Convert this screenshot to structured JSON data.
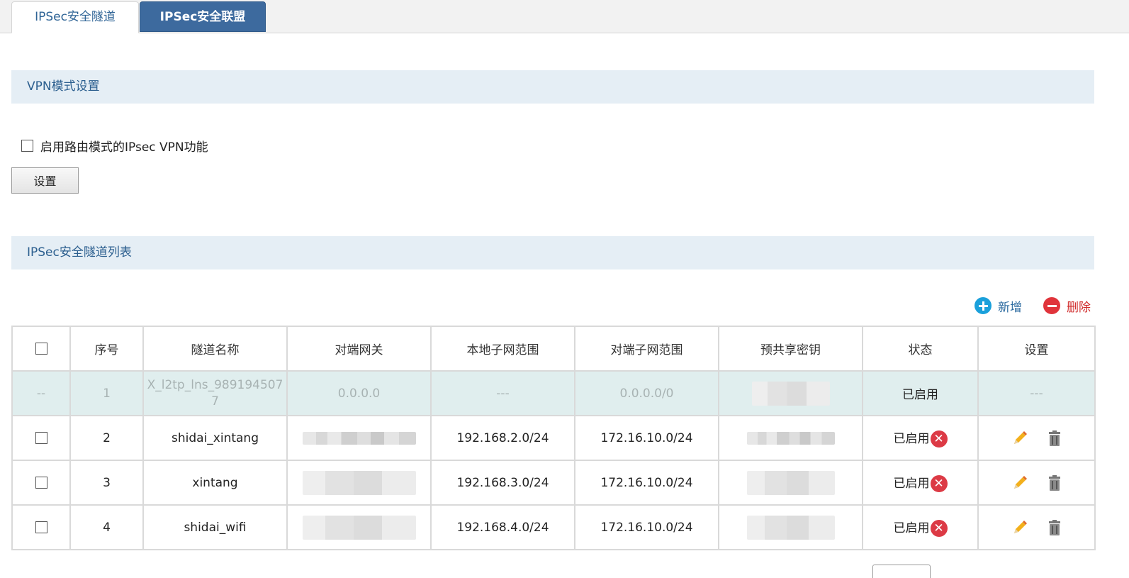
{
  "tabs": [
    {
      "label": "IPSec安全隧道",
      "active": true
    },
    {
      "label": "IPSec安全联盟",
      "active": false
    }
  ],
  "vpn_section": {
    "title": "VPN模式设置",
    "checkbox_label": "启用路由模式的IPsec VPN功能",
    "checkbox_checked": false,
    "button_label": "设置"
  },
  "list_section": {
    "title": "IPSec安全隧道列表",
    "add_label": "新增",
    "delete_label": "删除"
  },
  "table": {
    "headers": [
      "序号",
      "隧道名称",
      "对端网关",
      "本地子网范围",
      "对端子网范围",
      "预共享密钥",
      "状态",
      "设置"
    ],
    "rows": [
      {
        "select": "--",
        "index": "1",
        "name": "X_l2tp_lns_9891945077",
        "peer_gateway": "0.0.0.0",
        "local_subnet": "---",
        "peer_subnet": "0.0.0.0/0",
        "status": "已启用",
        "settings": "---"
      },
      {
        "index": "2",
        "name": "shidai_xintang",
        "local_subnet": "192.168.2.0/24",
        "peer_subnet": "172.16.10.0/24",
        "status": "已启用"
      },
      {
        "index": "3",
        "name": "xintang",
        "local_subnet": "192.168.3.0/24",
        "peer_subnet": "172.16.10.0/24",
        "status": "已启用"
      },
      {
        "index": "4",
        "name": "shidai_wifi",
        "local_subnet": "192.168.4.0/24",
        "peer_subnet": "172.16.10.0/24",
        "status": "已启用"
      }
    ]
  },
  "icons": {
    "add": "plus-circle-icon",
    "delete": "minus-circle-icon",
    "disable_status": "x-circle-icon",
    "edit": "pencil-icon",
    "remove": "trash-icon"
  },
  "colors": {
    "tab_inactive_bg": "#3d6a9e",
    "section_header_bg": "#e5eef5",
    "section_header_text": "#2c5f8f",
    "system_row_bg": "#e0eeee",
    "add_icon": "#1aa0db",
    "delete_icon": "#e0343b",
    "status_x": "#dc3a45"
  }
}
